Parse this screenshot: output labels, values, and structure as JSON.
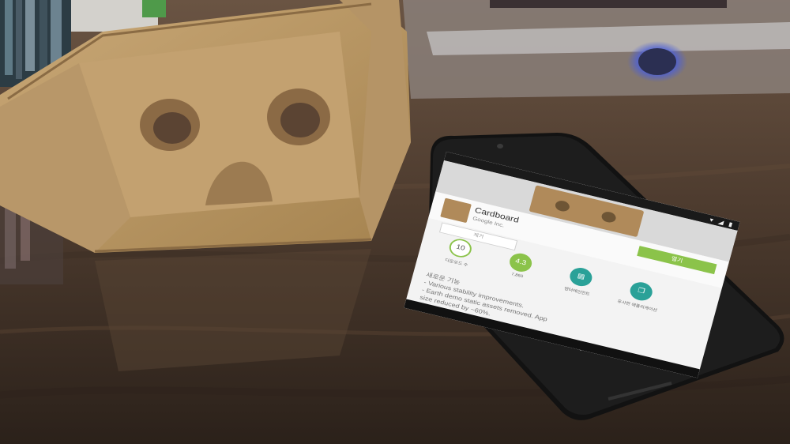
{
  "photo": {
    "subject": "Google Cardboard viewer beside a smartphone on a wooden table"
  },
  "phone_screen": {
    "app_name": "Cardboard",
    "developer": "Google Inc.",
    "open_button": "열기",
    "remove_button": "제거",
    "badges": [
      {
        "value": "10",
        "label": "다운로드 수",
        "color": "#ffffff",
        "text_color": "#555555"
      },
      {
        "value": "4.3",
        "label": "7,860",
        "color": "#8bc34a",
        "text_color": "#ffffff"
      },
      {
        "value": "",
        "label": "엔터테인먼트",
        "color": "#2aa198",
        "text_color": "#ffffff"
      },
      {
        "value": "",
        "label": "유사한 애플리케이션",
        "color": "#2aa198",
        "text_color": "#ffffff"
      }
    ],
    "whats_new_title": "새로운 기능",
    "whats_new_lines": [
      "- Various stability improvements.",
      "- Earth demo static assets removed. App",
      "size reduced by ~60%."
    ]
  }
}
